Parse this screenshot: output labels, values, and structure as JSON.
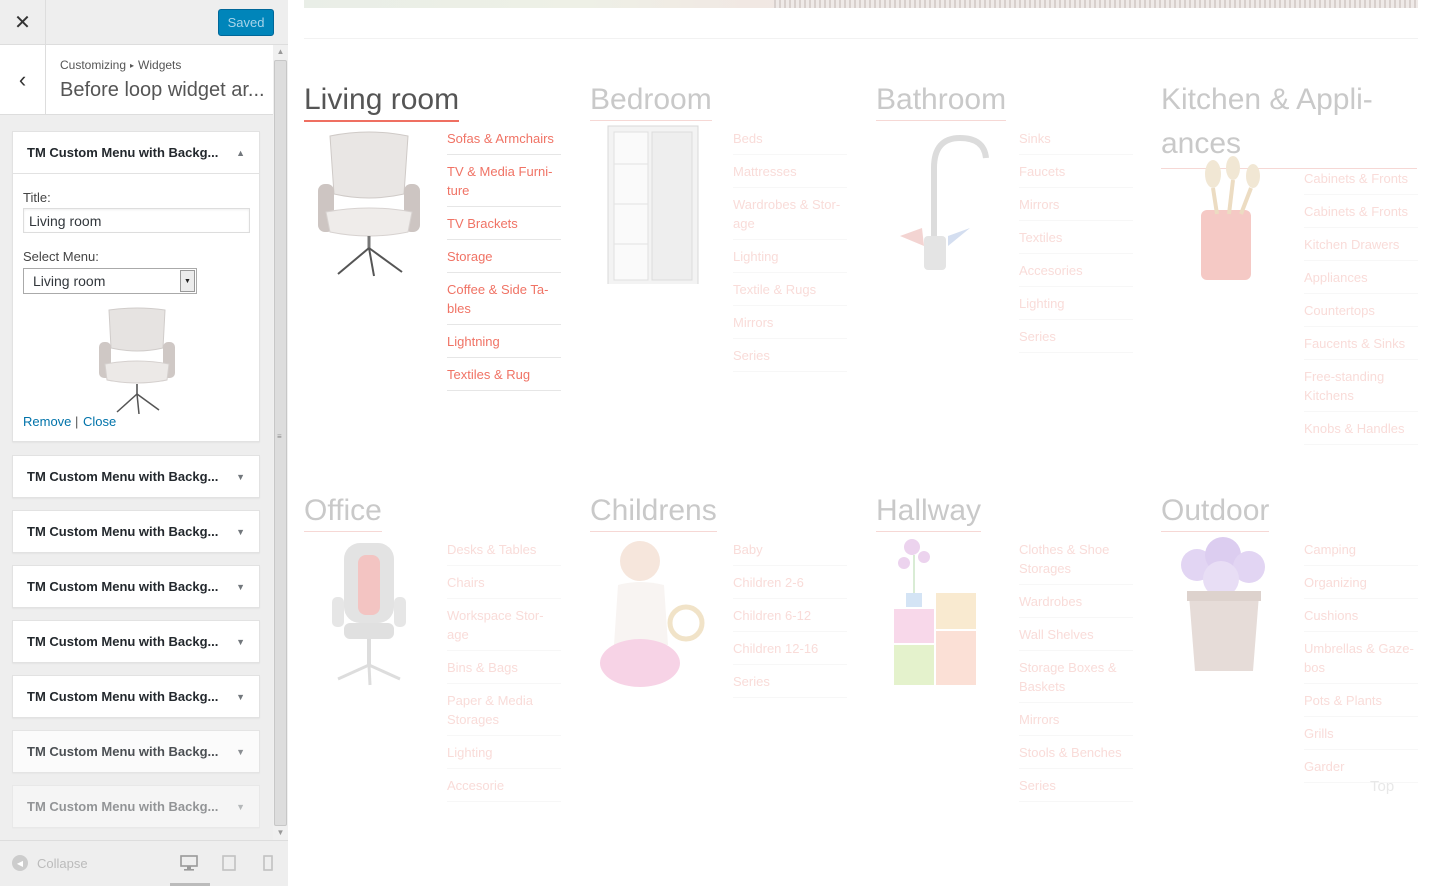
{
  "topbar": {
    "close_icon": "close-icon",
    "saved_label": "Saved"
  },
  "section": {
    "breadcrumb": [
      "Customizing",
      "Widgets"
    ],
    "title": "Before loop widget ar..."
  },
  "widget_open": {
    "title": "TM Custom Menu with Backg...",
    "title_label": "Title:",
    "title_value": "Living room",
    "select_label": "Select Menu:",
    "select_value": "Living room",
    "remove_label": "Remove",
    "separator": "|",
    "close_label": "Close"
  },
  "widgets_collapsed": [
    {
      "title": "TM Custom Menu with Backg..."
    },
    {
      "title": "TM Custom Menu with Backg..."
    },
    {
      "title": "TM Custom Menu with Backg..."
    },
    {
      "title": "TM Custom Menu with Backg..."
    },
    {
      "title": "TM Custom Menu with Backg..."
    },
    {
      "title": "TM Custom Menu with Backg..."
    },
    {
      "title": "TM Custom Menu with Backg..."
    }
  ],
  "footer": {
    "collapse_label": "Collapse"
  },
  "preview": {
    "categories": [
      {
        "title": "Living room",
        "links": [
          "Sofas & Armchairs",
          "TV & Media Furni-ture",
          "TV Brackets",
          "Storage",
          "Coffee & Side Ta-bles",
          "Lightning",
          "Textiles & Rug"
        ]
      },
      {
        "title": "Bedroom",
        "links": [
          "Beds",
          "Mattresses",
          "Wardrobes & Stor-age",
          "Lighting",
          "Textile & Rugs",
          "Mirrors",
          "Series"
        ]
      },
      {
        "title": "Bathroom",
        "links": [
          "Sinks",
          "Faucets",
          "Mirrors",
          "Textiles",
          "Accesories",
          "Lighting",
          "Series"
        ]
      },
      {
        "title": "Kitchen & Appli-ances",
        "links": [
          "Cabinets & Fronts",
          "Cabinets & Fronts",
          "Kitchen Drawers",
          "Appliances",
          "Countertops",
          "Faucents & Sinks",
          "Free-standing Kitchens",
          "Knobs & Handles"
        ]
      },
      {
        "title": "Office",
        "links": [
          "Desks & Tables",
          "Chairs",
          "Workspace Stor-age",
          "Bins & Bags",
          "Paper & Media Storages",
          "Lighting",
          "Accesorie"
        ]
      },
      {
        "title": "Childrens",
        "links": [
          "Baby",
          "Children 2-6",
          "Children 6-12",
          "Children 12-16",
          "Series"
        ]
      },
      {
        "title": "Hallway",
        "links": [
          "Clothes & Shoe Storages",
          "Wardrobes",
          "Wall Shelves",
          "Storage Boxes & Baskets",
          "Mirrors",
          "Stools & Benches",
          "Series"
        ]
      },
      {
        "title": "Outdoor",
        "links": [
          "Camping",
          "Organizing",
          "Cushions",
          "Umbrellas & Gaze-bos",
          "Pots & Plants",
          "Grills",
          "Garder"
        ]
      }
    ],
    "to_top": "Top"
  },
  "colors": {
    "accent": "#ef6f61",
    "primary_button": "#0085ba",
    "link": "#0073aa"
  }
}
